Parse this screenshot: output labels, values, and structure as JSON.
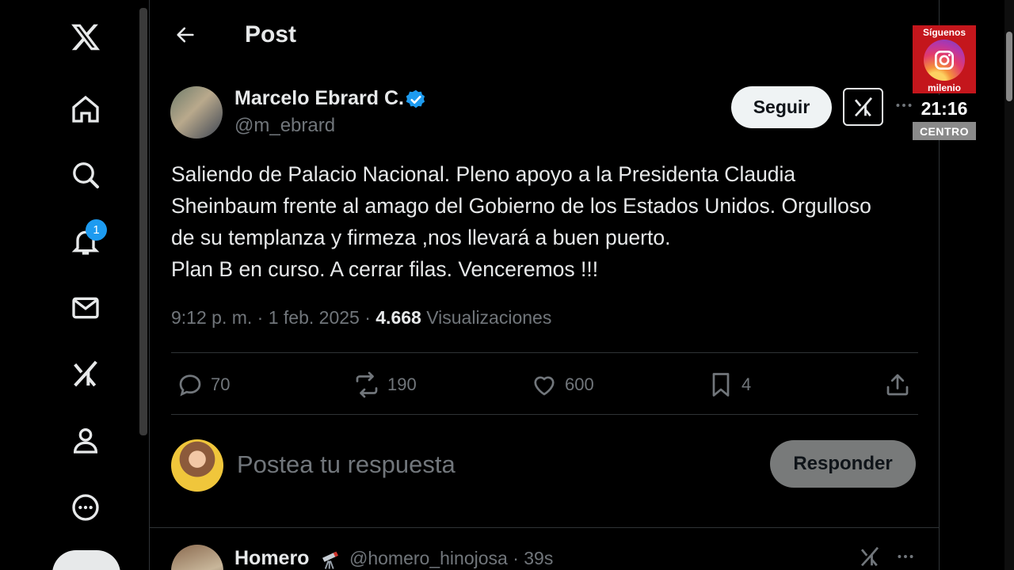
{
  "nav": {
    "badge_count": "1",
    "items": [
      {
        "icon": "x-logo-icon"
      },
      {
        "icon": "home-icon"
      },
      {
        "icon": "search-icon"
      },
      {
        "icon": "bell-icon"
      },
      {
        "icon": "mail-icon"
      },
      {
        "icon": "grok-icon"
      },
      {
        "icon": "profile-icon"
      },
      {
        "icon": "more-circle-icon"
      }
    ]
  },
  "header": {
    "title": "Post"
  },
  "post": {
    "author_name": "Marcelo Ebrard C.",
    "author_handle": "@m_ebrard",
    "follow_label": "Seguir",
    "text_lines": [
      "Saliendo de Palacio Nacional. Pleno apoyo a la Presidenta Claudia",
      "Sheinbaum frente al amago del Gobierno de los Estados Unidos. Orgulloso",
      "de su templanza y firmeza ,nos llevará a buen puerto.",
      "Plan B en curso. A cerrar filas. Venceremos !!!"
    ],
    "timestamp": "9:12 p. m. · 1 feb. 2025 · ",
    "views_count": "4.668",
    "views_label": " Visualizaciones",
    "actions": {
      "replies": "70",
      "reposts": "190",
      "likes": "600",
      "bookmarks": "4"
    }
  },
  "reply_box": {
    "placeholder": "Postea tu respuesta",
    "button_label": "Responder"
  },
  "next_post": {
    "author_name": "Homero",
    "handle_time": "@homero_hinojosa · 39s"
  },
  "overlay": {
    "follow_text": "Síguenos",
    "brand": "milenio",
    "time": "21:16",
    "zone": "CENTRO"
  },
  "colors": {
    "accent": "#1d9bf0",
    "muted": "#71767b",
    "broadcast_red": "#c4161c"
  }
}
